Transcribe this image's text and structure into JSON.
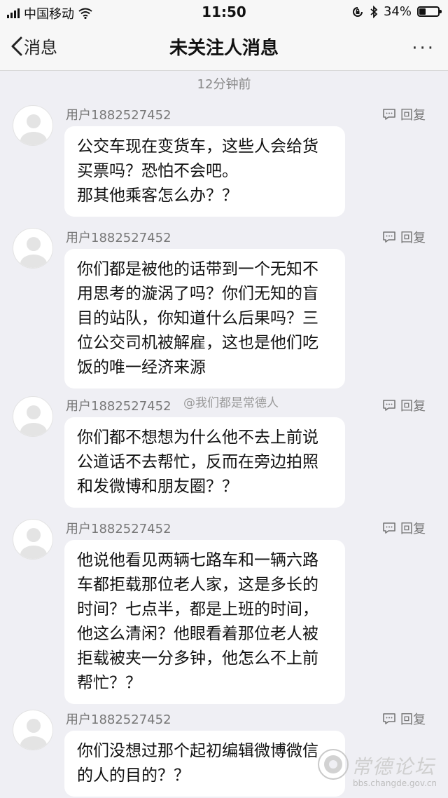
{
  "status_bar": {
    "carrier": "中国移动",
    "time": "11:50",
    "battery": "34%",
    "battery_level": 0.34
  },
  "nav": {
    "back_label": "消息",
    "title": "未关注人消息",
    "more": "···"
  },
  "timestamp": "12分钟前",
  "reply_label": "回复",
  "messages": [
    {
      "user": "用户1882527452",
      "text": "公交车现在变货车，这些人会给货\n买票吗？恐怕不会吧。\n那其他乘客怎么办？？"
    },
    {
      "user": "用户1882527452",
      "text": "你们都是被他的话带到一个无知不\n用思考的漩涡了吗？你们无知的盲\n目的站队，你知道什么后果吗？三\n位公交司机被解雇，这也是他们吃\n饭的唯一经济来源"
    },
    {
      "user": "用户1882527452",
      "text": "你们都不想想为什么他不去上前说\n公道话不去帮忙，反而在旁边拍照\n和发微博和朋友圈？？"
    },
    {
      "user": "用户1882527452",
      "text": "他说他看见两辆七路车和一辆六路\n车都拒载那位老人家，这是多长的\n时间？七点半，都是上班的时间，\n他这么清闲？他眼看着那位老人被\n拒载被夹一分多钟，他怎么不上前\n帮忙？？"
    },
    {
      "user": "用户1882527452",
      "text": "你们没想过那个起初编辑微博微信\n的人的目的？？"
    }
  ],
  "watermark": "@我们都是常德人",
  "forum_logo": {
    "name": "常德论坛",
    "url": "bbs.changde.gov.cn"
  }
}
